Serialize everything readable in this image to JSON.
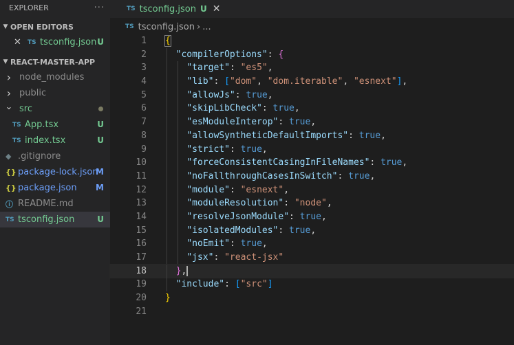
{
  "explorer": {
    "title": "EXPLORER",
    "more": "···",
    "open_editors": {
      "label": "OPEN EDITORS",
      "items": [
        {
          "close": "✕",
          "icon": "TS",
          "name": "tsconfig.json",
          "badge": "U"
        }
      ]
    },
    "project": {
      "label": "REACT-MASTER-APP",
      "items": [
        {
          "twisty": "›",
          "name": "node_modules"
        },
        {
          "twisty": "›",
          "name": "public"
        },
        {
          "twisty": "⌄",
          "name": "src"
        },
        {
          "icon": "TS",
          "name": "App.tsx",
          "badge": "U"
        },
        {
          "icon": "TS",
          "name": "index.tsx",
          "badge": "U"
        },
        {
          "icon": "◆",
          "name": ".gitignore"
        },
        {
          "icon": "{}",
          "name": "package-lock.json",
          "badge": "M"
        },
        {
          "icon": "{}",
          "name": "package.json",
          "badge": "M"
        },
        {
          "icon": "ⓘ",
          "name": "README.md"
        },
        {
          "icon": "TS",
          "name": "tsconfig.json",
          "badge": "U"
        }
      ]
    }
  },
  "tab": {
    "icon": "TS",
    "name": "tsconfig.json",
    "badge": "U",
    "close": "✕"
  },
  "breadcrumb": {
    "icon": "TS",
    "file": "tsconfig.json",
    "sep": "›",
    "rest": "..."
  },
  "colors": {
    "untracked": "#73c991",
    "modified": "#e2c08d",
    "json_key": "#9cdcfe",
    "string": "#ce9178",
    "keyword": "#569cd6"
  },
  "code": {
    "line_numbers": [
      "1",
      "2",
      "3",
      "4",
      "5",
      "6",
      "7",
      "8",
      "9",
      "10",
      "11",
      "12",
      "13",
      "14",
      "15",
      "16",
      "17",
      "18",
      "19",
      "20",
      "21"
    ],
    "current_line": "18",
    "lines": [
      "{",
      "  \"compilerOptions\": {",
      "    \"target\": \"es5\",",
      "    \"lib\": [\"dom\", \"dom.iterable\", \"esnext\"],",
      "    \"allowJs\": true,",
      "    \"skipLibCheck\": true,",
      "    \"esModuleInterop\": true,",
      "    \"allowSyntheticDefaultImports\": true,",
      "    \"strict\": true,",
      "    \"forceConsistentCasingInFileNames\": true,",
      "    \"noFallthroughCasesInSwitch\": true,",
      "    \"module\": \"esnext\",",
      "    \"moduleResolution\": \"node\",",
      "    \"resolveJsonModule\": true,",
      "    \"isolatedModules\": true,",
      "    \"noEmit\": true,",
      "    \"jsx\": \"react-jsx\"",
      "  },",
      "  \"include\": [\"src\"]",
      "}",
      ""
    ]
  }
}
